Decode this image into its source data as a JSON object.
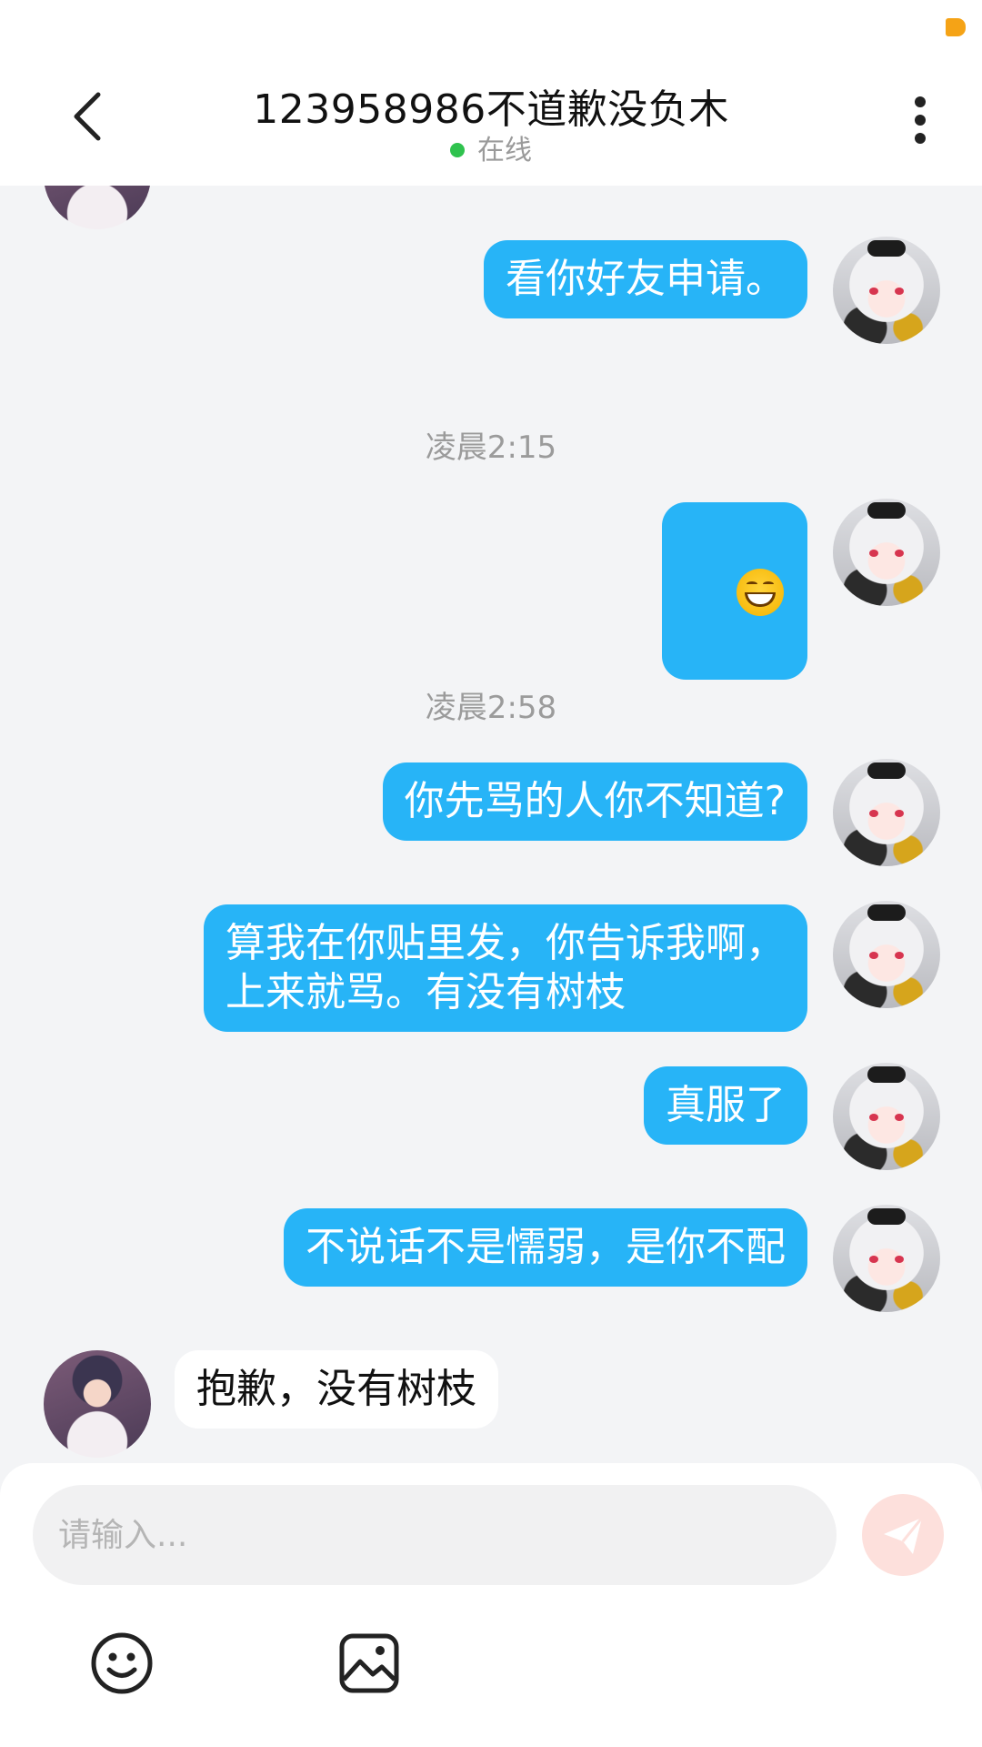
{
  "header": {
    "title": "123958986不道歉没负木",
    "status": "在线"
  },
  "messages": [
    {
      "side": "out",
      "text": "看你好友申请。"
    },
    {
      "type": "time",
      "text": "凌晨2:15"
    },
    {
      "side": "out",
      "emoji": "grinning-face"
    },
    {
      "type": "time",
      "text": "凌晨2:58"
    },
    {
      "side": "out",
      "text": "你先骂的人你不知道?"
    },
    {
      "side": "out",
      "text": "算我在你贴里发，你告诉我啊，\n上来就骂。有没有树枝"
    },
    {
      "side": "out",
      "text": "真服了"
    },
    {
      "side": "out",
      "text": "不说话不是懦弱，是你不配"
    },
    {
      "side": "in",
      "text": "抱歉，没有树枝"
    }
  ],
  "input": {
    "placeholder": "请输入..."
  },
  "colors": {
    "outgoing_bubble": "#27b4f7",
    "incoming_bubble": "#ffffff",
    "background": "#f3f4f6",
    "online_dot": "#2fc24e",
    "send_button": "#fde0dc"
  },
  "icons": [
    "back-arrow-icon",
    "more-vertical-icon",
    "send-icon",
    "emoji-icon",
    "image-icon"
  ]
}
